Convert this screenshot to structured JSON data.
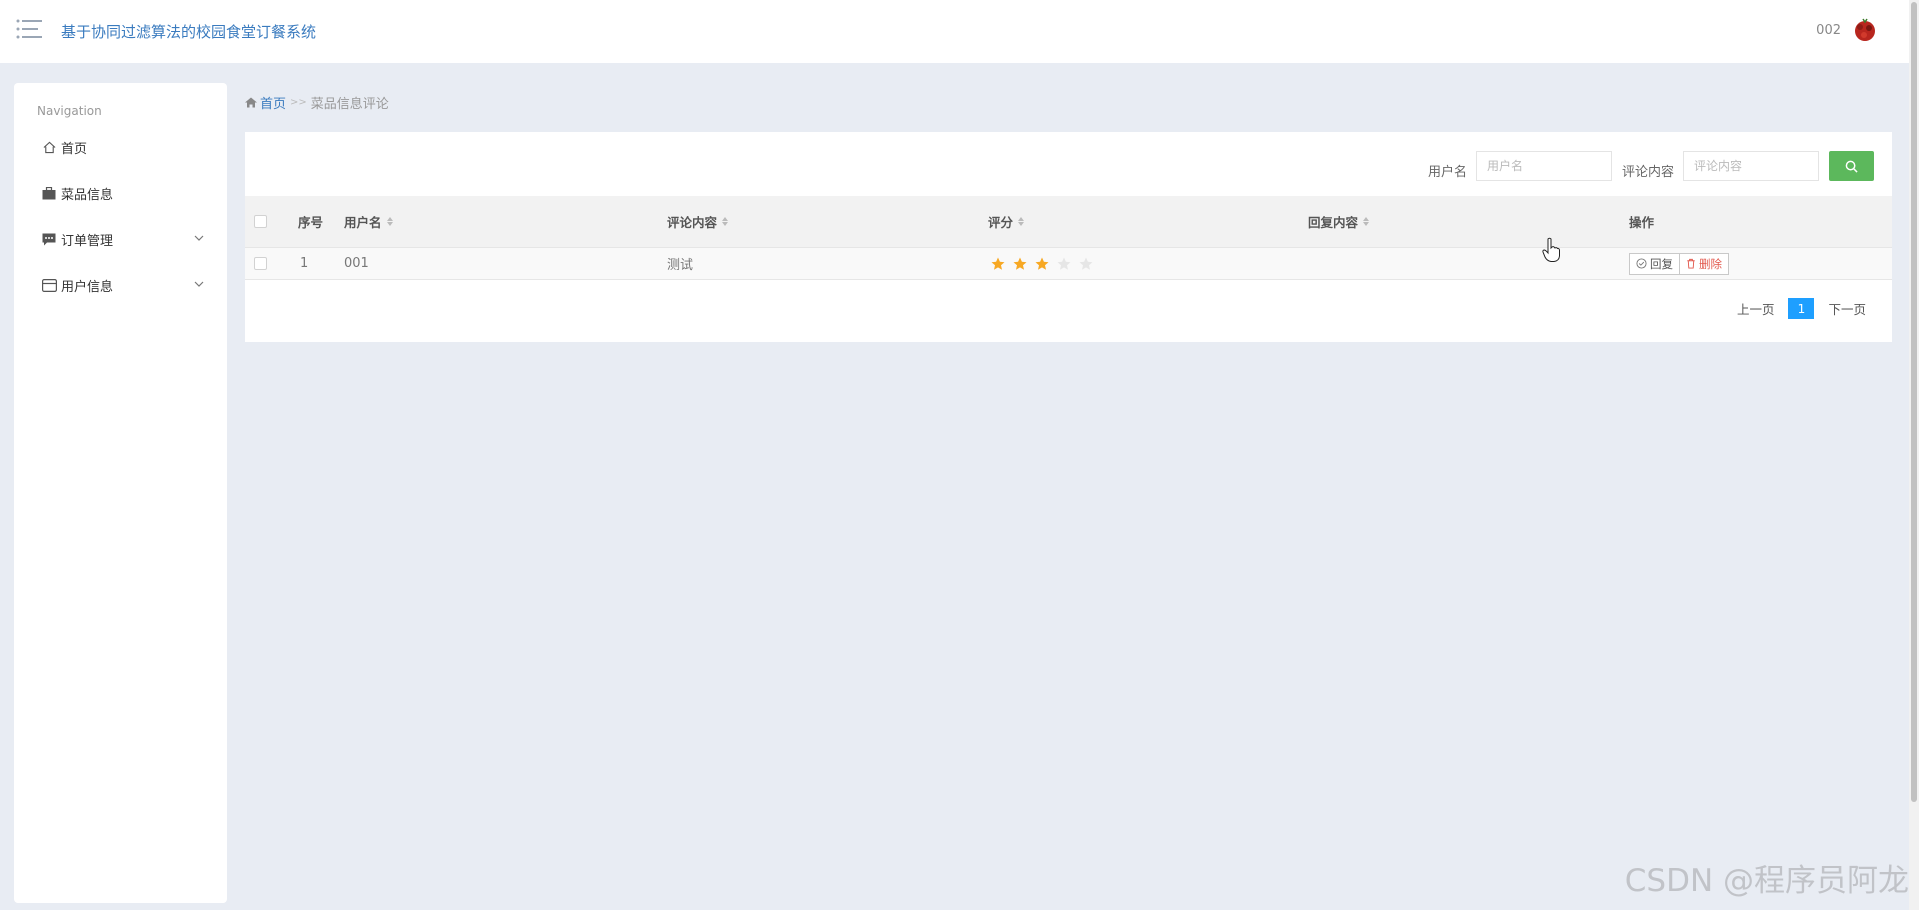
{
  "header": {
    "title": "基于协同过滤算法的校园食堂订餐系统",
    "user_name": "002"
  },
  "sidebar": {
    "nav_title": "Navigation",
    "items": [
      {
        "label": "首页",
        "icon": "home-icon"
      },
      {
        "label": "菜品信息",
        "icon": "briefcase-icon"
      },
      {
        "label": "订单管理",
        "icon": "chat-icon"
      },
      {
        "label": "用户信息",
        "icon": "card-icon"
      }
    ]
  },
  "breadcrumb": {
    "home": "首页",
    "separator": ">>",
    "current": "菜品信息评论"
  },
  "search": {
    "username_label": "用户名",
    "username_placeholder": "用户名",
    "content_label": "评论内容",
    "content_placeholder": "评论内容"
  },
  "table": {
    "columns": [
      "序号",
      "用户名",
      "评论内容",
      "评分",
      "回复内容",
      "操作"
    ],
    "rows": [
      {
        "index": "1",
        "username": "001",
        "content": "测试",
        "rating": 3,
        "max_rating": 5,
        "reply": ""
      }
    ],
    "reply_button": "回复",
    "delete_button": "删除"
  },
  "pagination": {
    "prev": "上一页",
    "current": "1",
    "next": "下一页"
  },
  "watermark": "CSDN @程序员阿龙",
  "colors": {
    "accent": "#3a7bbf",
    "search_button": "#5cb85c",
    "page_active": "#1e9fff",
    "star_on": "#f7a823",
    "star_off": "#e6e6e6",
    "delete": "#e2574c"
  }
}
